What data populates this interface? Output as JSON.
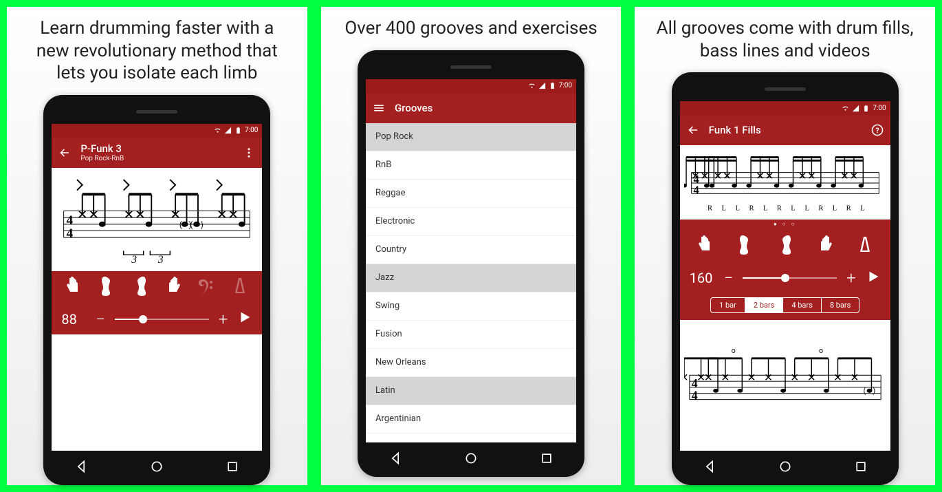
{
  "panels": [
    {
      "caption": "Learn drumming faster with a new revolutionary method that lets you isolate each limb"
    },
    {
      "caption": "Over 400 grooves and exercises"
    },
    {
      "caption": "All grooves come with drum fills, bass lines and videos"
    }
  ],
  "status": {
    "time": "7:00"
  },
  "screen1": {
    "title": "P-Funk 3",
    "subtitle": "Pop Rock-RnB",
    "tempo": "88",
    "triplet": "3"
  },
  "screen2": {
    "title": "Grooves",
    "items": [
      "Pop Rock",
      "RnB",
      "Reggae",
      "Electronic",
      "Country",
      "Jazz",
      "Swing",
      "Fusion",
      "New Orleans",
      "Latin",
      "Argentinian"
    ],
    "selected": [
      0,
      5,
      9
    ]
  },
  "screen3": {
    "title": "Funk 1 Fills",
    "tempo": "160",
    "bars": [
      "1 bar",
      "2 bars",
      "4 bars",
      "8 bars"
    ],
    "bars_active": 1,
    "sticking": [
      "R",
      "L",
      "L",
      "R",
      "L",
      "R",
      "L",
      "L",
      "R",
      "L",
      "R",
      "L"
    ]
  }
}
